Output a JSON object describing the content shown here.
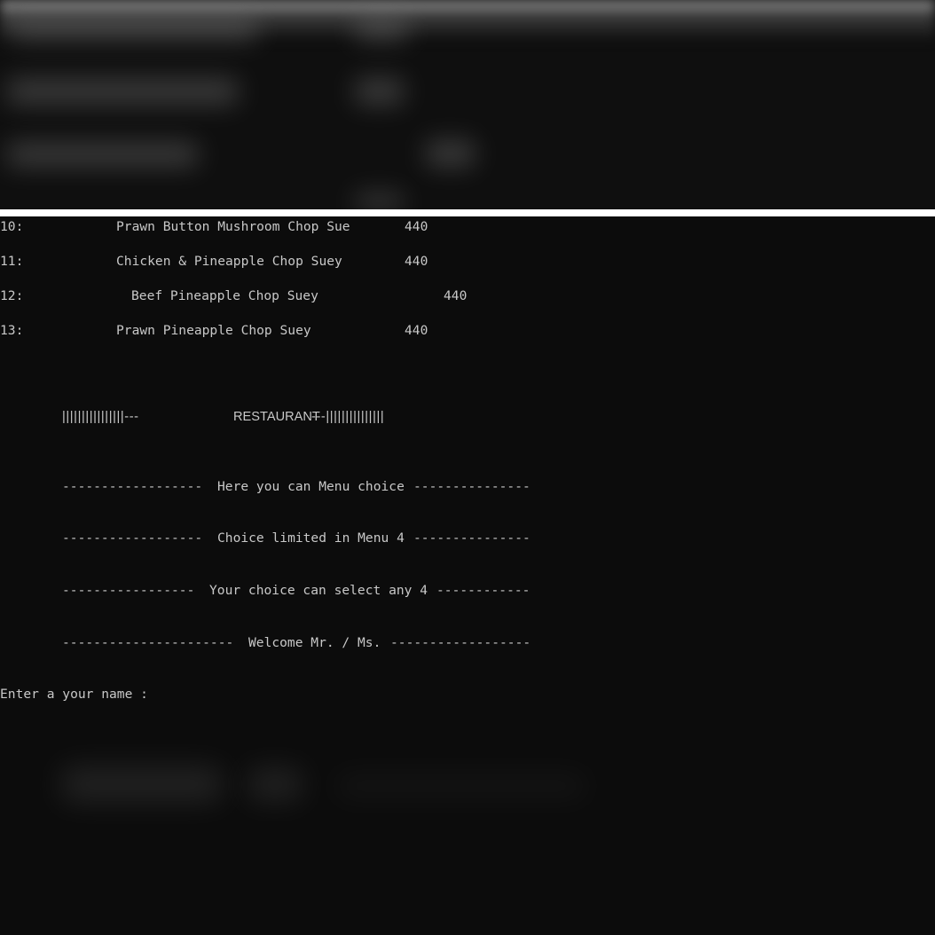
{
  "menu_items": [
    {
      "index": "10:",
      "name": "Prawn Button Mushroom Chop Sue",
      "price": "440"
    },
    {
      "index": "11:",
      "name": "Chicken & Pineapple Chop Suey",
      "price": "440"
    },
    {
      "index": "12:",
      "name": "Beef Pineapple Chop Suey",
      "price": "440"
    },
    {
      "index": "13:",
      "name": "Prawn Pineapple Chop Suey",
      "price": "440"
    }
  ],
  "banner": {
    "left_bars": "||||||||||||||||---",
    "title": "RESTAURANT",
    "right_bars": "---|||||||||||||||"
  },
  "info_lines": [
    {
      "left": "------------------",
      "text": "Here you can Menu choice",
      "right": "---------------"
    },
    {
      "left": "------------------",
      "text": "Choice limited in Menu 4",
      "right": "---------------"
    },
    {
      "left": "-----------------",
      "text": "Your choice can select any 4",
      "right": "------------"
    },
    {
      "left": "----------------------",
      "text": "Welcome Mr. / Ms.",
      "right": "------------------"
    }
  ],
  "prompt": "Enter a your name :",
  "colors": {
    "background": "#0c0c0c",
    "text": "#c8c8c8",
    "divider": "#ffffff"
  }
}
